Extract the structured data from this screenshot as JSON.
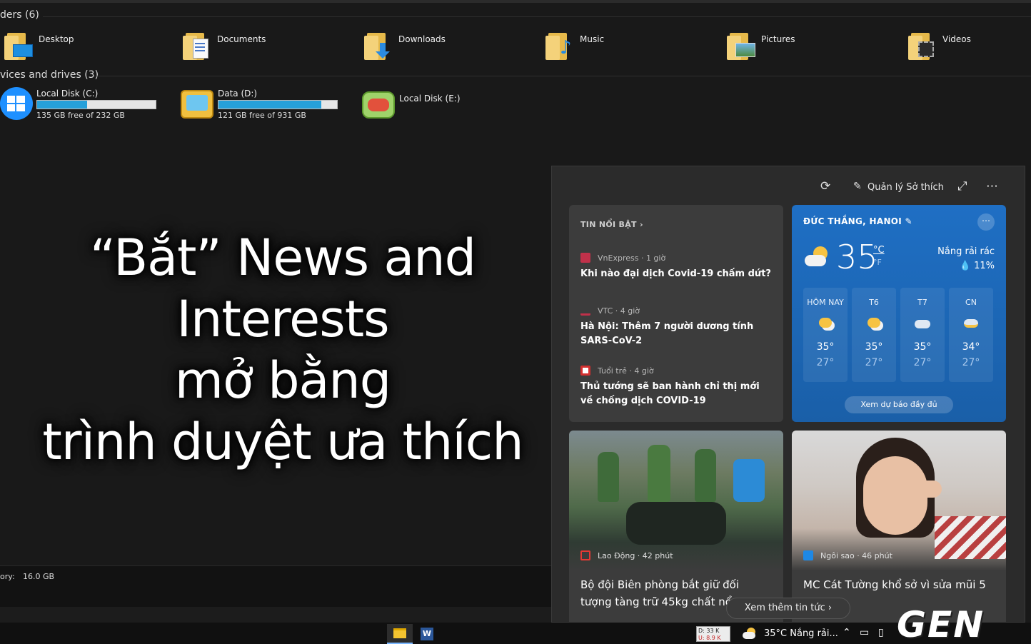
{
  "explorer": {
    "folders_header": "ders (6)",
    "folders": [
      {
        "label": "Desktop",
        "icon": "desktop-folder-icon"
      },
      {
        "label": "Documents",
        "icon": "documents-folder-icon"
      },
      {
        "label": "Downloads",
        "icon": "downloads-folder-icon"
      },
      {
        "label": "Music",
        "icon": "music-folder-icon"
      },
      {
        "label": "Pictures",
        "icon": "pictures-folder-icon"
      },
      {
        "label": "Videos",
        "icon": "videos-folder-icon"
      }
    ],
    "drives_header": "vices and drives (3)",
    "drives": [
      {
        "label": "Local Disk (C:)",
        "free": "135 GB free of 232 GB",
        "used_fraction": 0.42
      },
      {
        "label": "Data (D:)",
        "free": "121 GB free of 931 GB",
        "used_fraction": 0.87
      },
      {
        "label": "Local Disk (E:)"
      }
    ],
    "memory_label": "ory:",
    "memory_value": "16.0 GB"
  },
  "caption": {
    "line1": "“Bắt” News and Interests",
    "line2": "mở bằng",
    "line3": "trình duyệt ưa thích"
  },
  "panel": {
    "manage_label": "Quản lý Sở thích",
    "top_news": {
      "header": "TIN NỔI BẬT  ›",
      "items": [
        {
          "source": "VnExpress · 1 giờ",
          "title": "Khi nào đại dịch Covid-19 chấm dứt?",
          "color": "#c0314a"
        },
        {
          "source": "VTC · 4 giờ",
          "title": "Hà Nội: Thêm 7 người dương tính SARS-CoV-2",
          "color": "#c0314a"
        },
        {
          "source": "Tuổi trẻ · 4 giờ",
          "title": "Thủ tướng sẽ ban hành chỉ thị mới về chống dịch COVID-19",
          "color": "#d32f2f"
        }
      ]
    },
    "weather": {
      "location": "ĐỨC THẮNG, HANOI",
      "temp": "35",
      "unit_c": "°C",
      "unit_f": "°F",
      "condition": "Nắng rải rác",
      "humidity": "💧 11%",
      "days": [
        {
          "name": "HÔM NAY",
          "hi": "35°",
          "lo": "27°",
          "icon": "sun-cloud-icon"
        },
        {
          "name": "T6",
          "hi": "35°",
          "lo": "27°",
          "icon": "sun-cloud-icon"
        },
        {
          "name": "T7",
          "hi": "35°",
          "lo": "27°",
          "icon": "cloud-icon"
        },
        {
          "name": "CN",
          "hi": "34°",
          "lo": "27°",
          "icon": "storm-icon"
        }
      ],
      "forecast_button": "Xem dự báo đầy đủ"
    },
    "photo_news": [
      {
        "source": "Lao Động · 42 phút",
        "title": "Bộ đội Biên phòng bắt giữ đối tượng tàng trữ 45kg chất nổ"
      },
      {
        "source": "Ngôi sao · 46 phút",
        "title": "MC Cát Tường khổ sở vì sửa mũi 5 ..."
      }
    ],
    "more_news": "Xem thêm tin tức  ›"
  },
  "taskbar": {
    "netspeed_down": "D: 33 K",
    "netspeed_up": "U: 8.9 K",
    "weather": "35°C  Nắng rải..."
  },
  "watermark": "GEN"
}
